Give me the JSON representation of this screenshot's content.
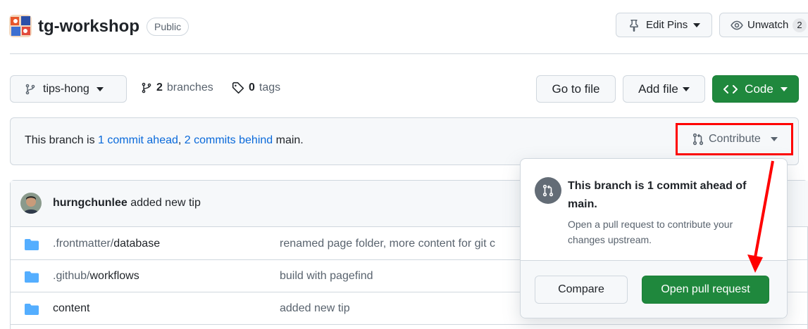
{
  "repo": {
    "name": "tg-workshop",
    "visibility": "Public",
    "avatar_icon": "repo-avatar-icon"
  },
  "header": {
    "edit_pins_label": "Edit Pins",
    "unwatch_label": "Unwatch",
    "watch_count": "2"
  },
  "branch_bar": {
    "current_branch": "tips-hong",
    "branches_count": "2",
    "branches_label": "branches",
    "tags_count": "0",
    "tags_label": "tags",
    "go_to_file": "Go to file",
    "add_file": "Add file",
    "code": "Code"
  },
  "compare": {
    "prefix": "This branch is ",
    "ahead": "1 commit ahead",
    "separator": ", ",
    "behind": "2 commits behind",
    "suffix": " main.",
    "contribute_label": "Contribute"
  },
  "latest_commit": {
    "author": "hurngchunlee",
    "message": "added new tip"
  },
  "files": [
    {
      "dir": ".frontmatter/",
      "name": "database",
      "message": "renamed page folder, more content for git c"
    },
    {
      "dir": ".github/",
      "name": "workflows",
      "message": "build with pagefind"
    },
    {
      "dir": "",
      "name": "content",
      "message": "added new tip"
    }
  ],
  "popover": {
    "title": "This branch is 1 commit ahead of main.",
    "description": "Open a pull request to contribute your changes upstream.",
    "compare_label": "Compare",
    "open_pr_label": "Open pull request"
  },
  "colors": {
    "primary_green": "#1f883d",
    "link_blue": "#0969da",
    "highlight_red": "#ff0000"
  }
}
